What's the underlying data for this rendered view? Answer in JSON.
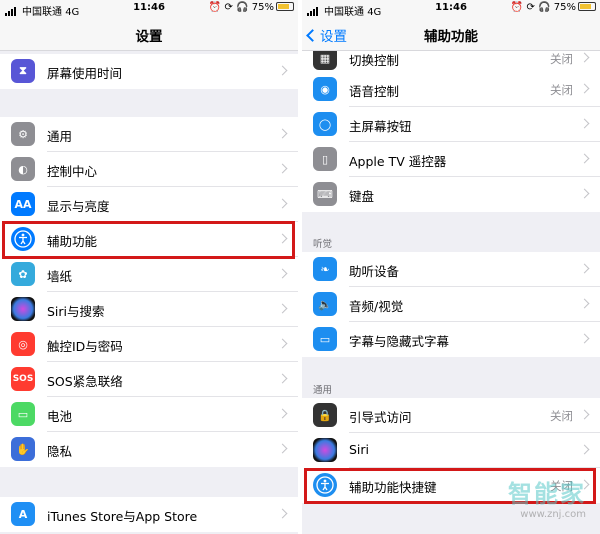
{
  "status_bar": {
    "carrier": "中国联通",
    "network": "4G",
    "time": "11:46",
    "battery": "75%"
  },
  "left": {
    "title": "设置",
    "rows": [
      {
        "label": "屏幕使用时间",
        "icon": "hourglass-icon",
        "color": "#5856d6"
      },
      {
        "label": "通用",
        "icon": "gear-icon",
        "color": "#8e8e93"
      },
      {
        "label": "控制中心",
        "icon": "toggle-icon",
        "color": "#8e8e93"
      },
      {
        "label": "显示与亮度",
        "icon": "text-size-icon",
        "color": "#007aff",
        "glyph": "AA"
      },
      {
        "label": "辅助功能",
        "icon": "accessibility-icon",
        "color": "#007aff"
      },
      {
        "label": "墙纸",
        "icon": "flower-icon",
        "color": "#35aadc"
      },
      {
        "label": "Siri与搜索",
        "icon": "siri-icon",
        "color": "#222222"
      },
      {
        "label": "触控ID与密码",
        "icon": "fingerprint-icon",
        "color": "#ff3b30"
      },
      {
        "label": "SOS紧急联络",
        "icon": "sos-icon",
        "color": "#ff3b30",
        "glyph": "SOS"
      },
      {
        "label": "电池",
        "icon": "battery-icon",
        "color": "#4cd964"
      },
      {
        "label": "隐私",
        "icon": "hand-icon",
        "color": "#3c6ed9"
      },
      {
        "label": "iTunes Store与App Store",
        "icon": "app-store-icon",
        "color": "#1f8ff4"
      }
    ]
  },
  "right": {
    "back_label": "设置",
    "title": "辅助功能",
    "section_hearing": "听觉",
    "section_general": "通用",
    "rows": [
      {
        "label": "切换控制",
        "value": "关闭",
        "icon": "switch-control-icon",
        "color": "#333333"
      },
      {
        "label": "语音控制",
        "value": "关闭",
        "icon": "voice-control-icon",
        "color": "#1d8ef0"
      },
      {
        "label": "主屏幕按钮",
        "value": "",
        "icon": "home-button-icon",
        "color": "#1d8ef0"
      },
      {
        "label": "Apple TV 遥控器",
        "value": "",
        "icon": "remote-icon",
        "color": "#8e8e93"
      },
      {
        "label": "键盘",
        "value": "",
        "icon": "keyboard-icon",
        "color": "#8e8e93"
      },
      {
        "label": "助听设备",
        "value": "",
        "icon": "ear-icon",
        "color": "#1d8ef0"
      },
      {
        "label": "音频/视觉",
        "value": "",
        "icon": "speaker-icon",
        "color": "#1d8ef0"
      },
      {
        "label": "字幕与隐藏式字幕",
        "value": "",
        "icon": "captions-icon",
        "color": "#1d8ef0"
      },
      {
        "label": "引导式访问",
        "value": "关闭",
        "icon": "lock-icon",
        "color": "#333333"
      },
      {
        "label": "Siri",
        "value": "",
        "icon": "siri-icon",
        "color": "#222222"
      },
      {
        "label": "辅助功能快捷键",
        "value": "关闭",
        "icon": "accessibility-icon",
        "color": "#1d8ef0"
      }
    ]
  },
  "watermark": {
    "main": "智能家",
    "sub": "www.znj.com"
  }
}
